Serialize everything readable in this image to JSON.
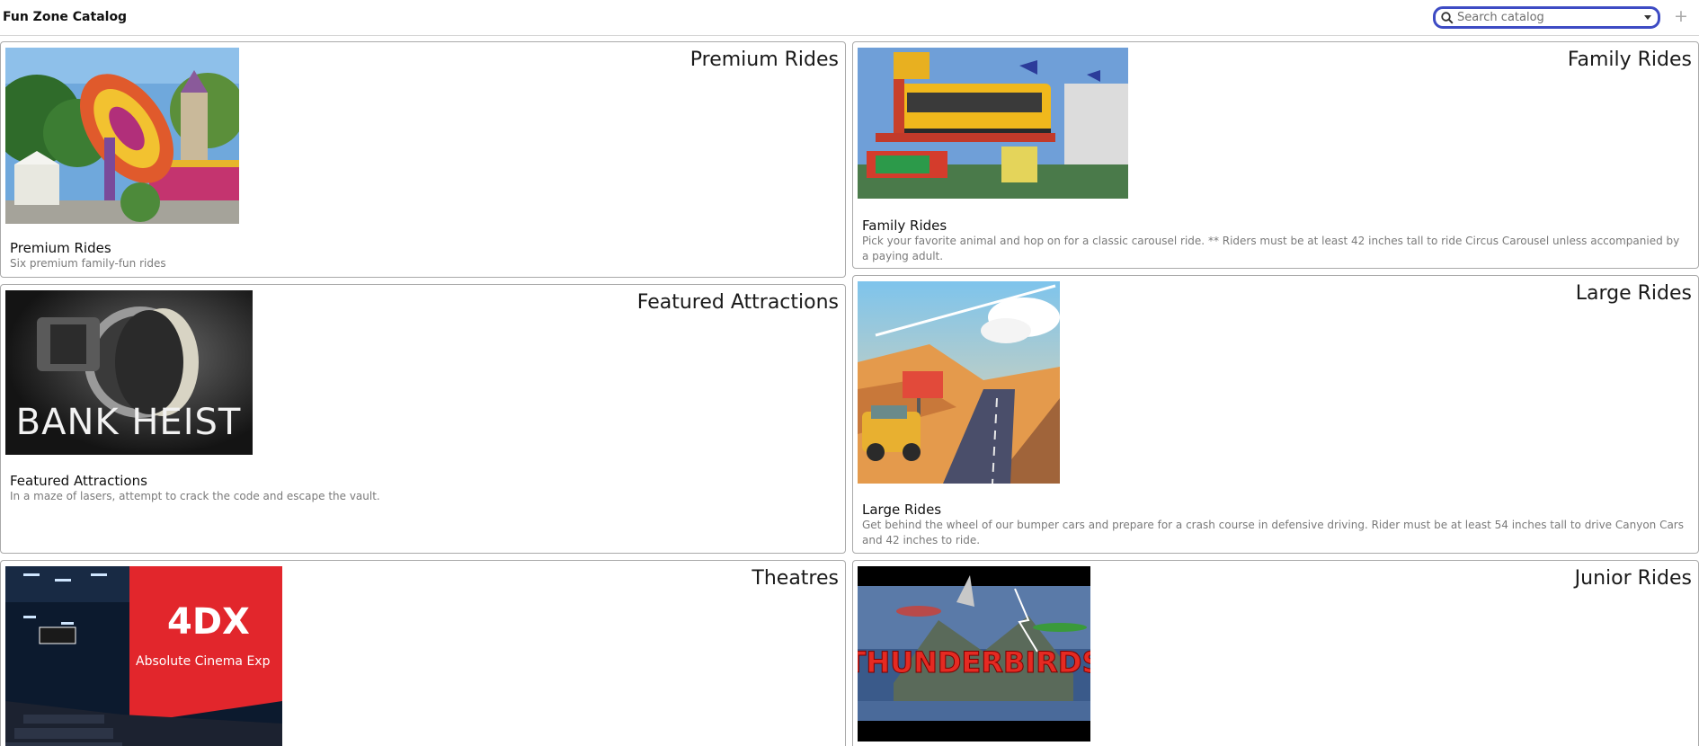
{
  "app": {
    "title": "Fun Zone Catalog"
  },
  "search": {
    "placeholder": "Search catalog",
    "icon": "search-icon",
    "dropdown_icon": "chevron-down-icon"
  },
  "add_button": {
    "label": "+"
  },
  "colors": {
    "search_border": "#3d4bc4",
    "card_border": "#a9a9a9",
    "desc_text": "#7a7a7a"
  },
  "cards": [
    {
      "heading": "Premium Rides",
      "title": "Premium Rides",
      "description": "Six premium family-fun rides",
      "image": "spinning thrill ride in park"
    },
    {
      "heading": "Family Rides",
      "title": "Family Rides",
      "description": "Pick your favorite animal and hop on for a classic carousel ride. ** Riders must be at least 42 inches tall to ride Circus Carousel unless accompanied by a paying adult.",
      "image": "crazy bus ride"
    },
    {
      "heading": "Featured Attractions",
      "title": "Featured Attractions",
      "description": "In a maze of lasers, attempt to crack the code and escape the vault.",
      "image": "bank vault door",
      "image_text": "BANK HEIST"
    },
    {
      "heading": "Large Rides",
      "title": "Large Rides",
      "description": "Get behind the wheel of our bumper cars and prepare for a crash course in defensive driving. Rider must be at least 54 inches tall to drive Canyon Cars and 42 inches to ride.",
      "image": "cartoon canyon road with car"
    },
    {
      "heading": "Theatres",
      "title": "Theatres",
      "description": "",
      "image": "4DX cinema auditorium",
      "image_text": "4DX",
      "image_subtext": "Absolute Cinema Exp"
    },
    {
      "heading": "Junior Rides",
      "title": "Junior Rides",
      "description": "",
      "image": "thunderbirds title art",
      "image_text": "THUNDERBIRDS"
    }
  ]
}
